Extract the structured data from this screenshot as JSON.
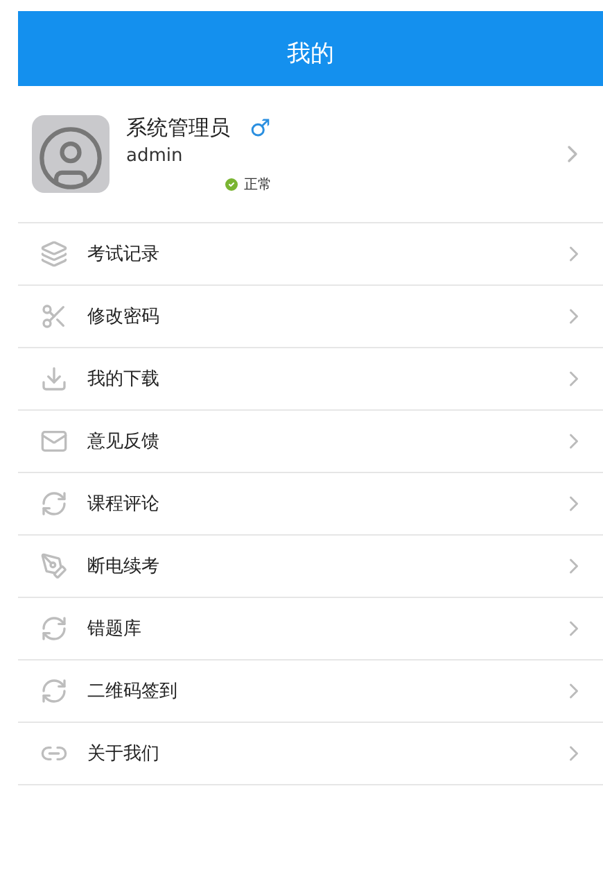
{
  "header": {
    "title": "我的"
  },
  "profile": {
    "name": "系统管理员",
    "gender_symbol": "♂",
    "username": "admin",
    "status": "正常"
  },
  "menu": [
    {
      "label": "考试记录",
      "kind": "layers"
    },
    {
      "label": "修改密码",
      "kind": "tools"
    },
    {
      "label": "我的下载",
      "kind": "download"
    },
    {
      "label": "意见反馈",
      "kind": "mail"
    },
    {
      "label": "课程评论",
      "kind": "refresh"
    },
    {
      "label": "断电续考",
      "kind": "pen"
    },
    {
      "label": "错题库",
      "kind": "refresh"
    },
    {
      "label": "二维码签到",
      "kind": "refresh"
    },
    {
      "label": "关于我们",
      "kind": "link"
    }
  ]
}
